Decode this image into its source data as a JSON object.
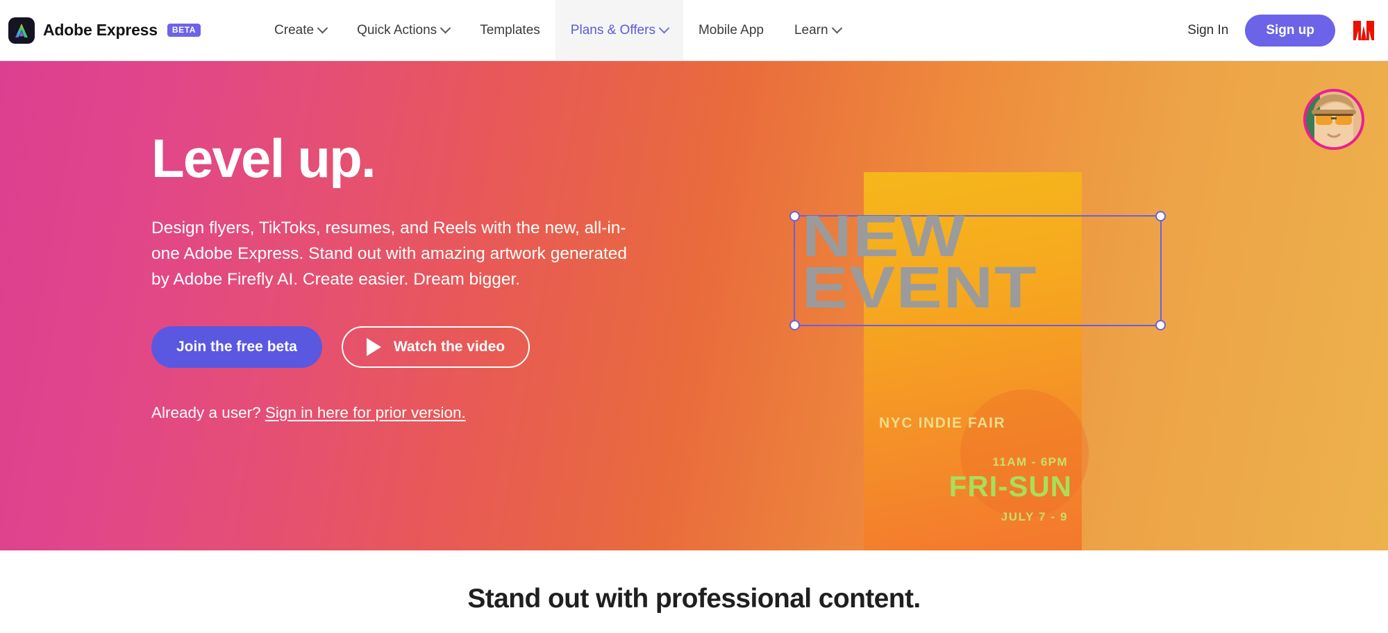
{
  "nav": {
    "brand": {
      "name": "Adobe Express",
      "badge": "BETA",
      "logo_icon": "adobe-express-logo-icon"
    },
    "items": [
      {
        "label": "Create",
        "has_chevron": true,
        "active": false
      },
      {
        "label": "Quick Actions",
        "has_chevron": true,
        "active": false
      },
      {
        "label": "Templates",
        "has_chevron": false,
        "active": false
      },
      {
        "label": "Plans & Offers",
        "has_chevron": true,
        "active": true
      },
      {
        "label": "Mobile App",
        "has_chevron": false,
        "active": false
      },
      {
        "label": "Learn",
        "has_chevron": true,
        "active": false
      }
    ],
    "sign_in": "Sign In",
    "sign_up": "Sign up",
    "adobe_mark_icon": "adobe-logo-icon"
  },
  "hero": {
    "title": "Level up.",
    "subtitle": "Design flyers, TikToks, resumes, and Reels with the new, all-in-one Adobe Express. Stand out with amazing artwork generated by Adobe Firefly AI. Create easier. Dream bigger.",
    "primary_cta": "Join the free beta",
    "secondary_cta": "Watch the video",
    "secondary_cta_icon": "play-icon",
    "prior_prefix": "Already a user? ",
    "prior_link": "Sign in here for prior version.",
    "avatar_icon": "user-avatar"
  },
  "artwork": {
    "selected_text": "NEW\nEVENT",
    "subtitle": "NYC INDIE FAIR",
    "time": "11AM - 6PM",
    "days": "FRI-SUN",
    "date": "JULY 7 - 9",
    "selection_handles": [
      "top-left",
      "top-right",
      "bottom-left",
      "bottom-right"
    ]
  },
  "section_below": {
    "title": "Stand out with professional content."
  },
  "colors": {
    "accent_purple": "#6c63e8",
    "cta_purple": "#5a58e0",
    "hero_gradient_start": "#dc3f90",
    "hero_gradient_mid": "#e96b3c",
    "hero_gradient_end": "#edb24c",
    "adobe_red": "#eb1000",
    "nav_active_bg": "#f5f5f5",
    "avatar_ring": "#ec1f8f",
    "selection_purple": "#6a5fe0"
  }
}
